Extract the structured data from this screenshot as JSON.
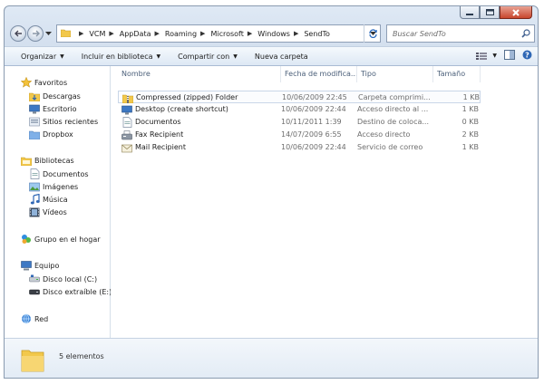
{
  "address": {
    "crumbs": [
      "VCM",
      "AppData",
      "Roaming",
      "Microsoft",
      "Windows",
      "SendTo"
    ]
  },
  "search": {
    "placeholder": "Buscar SendTo"
  },
  "toolbar": {
    "organize_label": "Organizar",
    "include_label": "Incluir en biblioteca",
    "share_label": "Compartir con",
    "new_folder_label": "Nueva carpeta"
  },
  "nav": {
    "favorites": "Favoritos",
    "favorites_items": [
      "Descargas",
      "Escritorio",
      "Sitios recientes",
      "Dropbox"
    ],
    "libraries": "Bibliotecas",
    "libraries_items": [
      "Documentos",
      "Imágenes",
      "Música",
      "Vídeos"
    ],
    "homegroup": "Grupo en el hogar",
    "computer": "Equipo",
    "computer_items": [
      "Disco local (C:)",
      "Disco extraíble (E:)"
    ],
    "network": "Red"
  },
  "columns": {
    "name": "Nombre",
    "date": "Fecha de modifica...",
    "type": "Tipo",
    "size": "Tamaño"
  },
  "files": [
    {
      "name": "Compressed (zipped) Folder",
      "date": "10/06/2009 22:45",
      "type": "Carpeta comprimi...",
      "size": "1 KB",
      "icon": "zip-folder-icon"
    },
    {
      "name": "Desktop (create shortcut)",
      "date": "10/06/2009 22:44",
      "type": "Acceso directo al ...",
      "size": "1 KB",
      "icon": "desktop-icon"
    },
    {
      "name": "Documentos",
      "date": "10/11/2011 1:39",
      "type": "Destino de coloca...",
      "size": "0 KB",
      "icon": "documents-icon"
    },
    {
      "name": "Fax Recipient",
      "date": "14/07/2009 6:55",
      "type": "Acceso directo",
      "size": "2 KB",
      "icon": "fax-icon"
    },
    {
      "name": "Mail Recipient",
      "date": "10/06/2009 22:44",
      "type": "Servicio de correo",
      "size": "1 KB",
      "icon": "mail-icon"
    }
  ],
  "status": {
    "count": "5 elementos"
  },
  "colors": {
    "accent": "#1e5aa8",
    "folder": "#f2c84b",
    "close": "#c8452c"
  }
}
